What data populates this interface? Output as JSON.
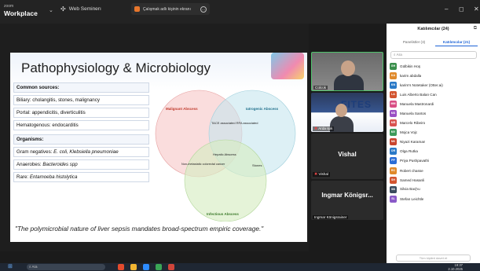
{
  "titlebar": {
    "brand_top": "zoom",
    "brand": "Workplace",
    "webinar": "Web Seminerı",
    "meeting_tab": "Çalışmak adlı kişinin ekranı",
    "minimize": "–",
    "restore": "◻",
    "close": "✕"
  },
  "slide": {
    "title": "Pathophysiology & Microbiology",
    "sources_header": "Common sources:",
    "biliary": "Biliary: cholangitis, stones, malignancy",
    "portal": "Portal: appendicitis, diverticulitis",
    "hematogenous": "Hematogenous: endocarditis",
    "organisms_header": "Organisms:",
    "gram_prefix": "Gram negatives: ",
    "gram_species": "E. coli, Klebsiella pneumoniae",
    "anaerobes_prefix": "Anaerobes: ",
    "anaerobes_species": "Bacteroides spp",
    "rare_prefix": "Rare: ",
    "rare_species": "Entamoeba histolytica",
    "quote": "\"The polymicrobial nature of liver sepsis mandates broad-spectrum empiric coverage.\"",
    "venn": {
      "malignant": "Malignant Abscess",
      "iatrogenic": "Iatrogenic Abscess",
      "infectious": "Infectious Abscess",
      "tace": "TACE associated RFA associated",
      "hepatic": "Hepatic Abscess",
      "nonmetastatic": "Non-metastatic colorectal cancer",
      "stones": "Stones"
    }
  },
  "tiles": {
    "t1_name": "Cülcük",
    "t2_name": "Arda Işık",
    "t2_banner": "FITES",
    "t3_big": "Vishal",
    "t3_name": "Vishal",
    "t4_big": "Ingmar Königsr...",
    "t4_name": "Ingmar Königsrainer"
  },
  "panel": {
    "title": "Katılımcılar (24)",
    "tab_panelists": "Panelistler (3)",
    "tab_attendees": "Katılımcılar (21)",
    "search_placeholder": "Ara",
    "invite": "Tüm kişileri davet et",
    "participants": [
      {
        "initials": "GH",
        "name": "Gülbikin Hoş",
        "color": "#3a8f4c"
      },
      {
        "initials": "KA",
        "name": "karim abdalla",
        "color": "#e08a2b"
      },
      {
        "initials": "KN",
        "name": "karim's Notetaker (Otter.ai)",
        "color": "#2a79c7"
      },
      {
        "initials": "LA",
        "name": "Luis Alberto Balan Can",
        "color": "#d35530"
      },
      {
        "initials": "MM",
        "name": "Manuela Mastronardi",
        "color": "#d84e84"
      },
      {
        "initials": "MS",
        "name": "Manuela Santos",
        "color": "#9a4fc4"
      },
      {
        "initials": "MR",
        "name": "Marcelo Ribeiro",
        "color": "#d9534f"
      },
      {
        "initials": "MV",
        "name": "Mojca Vojc",
        "color": "#3c9a5a"
      },
      {
        "initials": "NK",
        "name": "Niyazi Karaman",
        "color": "#c9452f"
      },
      {
        "initials": "OR",
        "name": "Olga Rutka",
        "color": "#2a79c7"
      },
      {
        "initials": "PP",
        "name": "Priya Pushpavathi",
        "color": "#2b6ed6"
      },
      {
        "initials": "RC",
        "name": "Robert chasse",
        "color": "#e08a2b"
      },
      {
        "initials": "SH",
        "name": "Samed Hasanli",
        "color": "#d35530"
      },
      {
        "initials": "SB",
        "name": "Silvia Bacիu",
        "color": "#3a4b5e"
      },
      {
        "initials": "SL",
        "name": "Stefan Leichtle",
        "color": "#8a5ac8"
      }
    ]
  },
  "taskbar": {
    "search": "Ara",
    "time": "19:37",
    "date": "2.10.2025"
  }
}
